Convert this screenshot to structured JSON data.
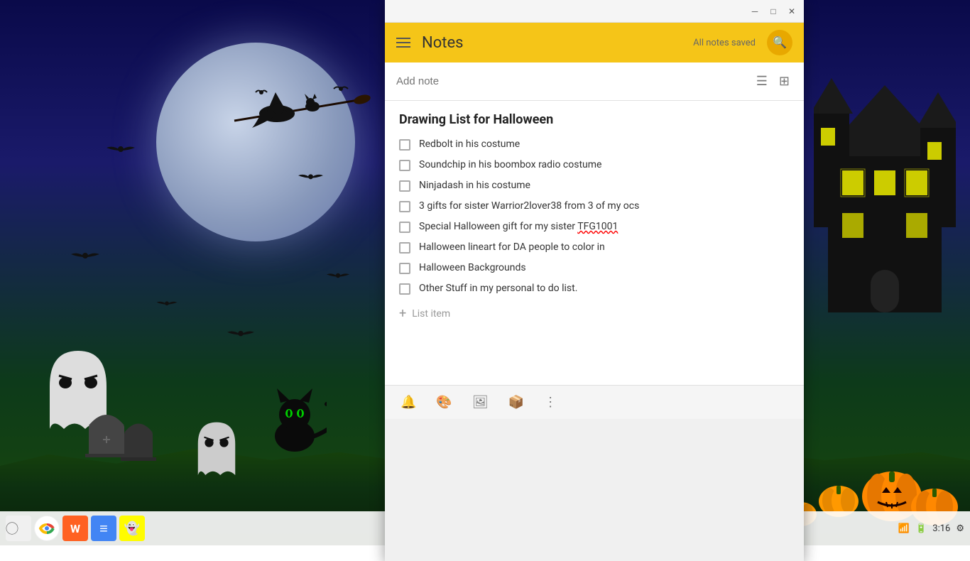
{
  "desktop": {
    "background_description": "Halloween night scene with moon, witch, haunted house, ghosts, bats, pumpkins"
  },
  "window": {
    "title": "Notes",
    "minimize_label": "minimize",
    "maximize_label": "maximize",
    "close_label": "close"
  },
  "notes_header": {
    "title": "Notes",
    "status": "All notes saved",
    "search_label": "search"
  },
  "add_note": {
    "placeholder": "Add note"
  },
  "note": {
    "title": "Drawing List for Halloween",
    "items": [
      {
        "id": 1,
        "text": "Redbolt in his costume",
        "checked": false
      },
      {
        "id": 2,
        "text": "Soundchip in his boombox radio costume",
        "checked": false
      },
      {
        "id": 3,
        "text": "Ninjadash in his costume",
        "checked": false
      },
      {
        "id": 4,
        "text": "3 gifts for sister Warrior2lover38 from 3 of my ocs",
        "checked": false
      },
      {
        "id": 5,
        "text": "Special Halloween gift for my sister TFG1001",
        "checked": false,
        "has_link": true,
        "link_text": "TFG1001"
      },
      {
        "id": 6,
        "text": "Halloween lineart for DA people to color in",
        "checked": false
      },
      {
        "id": 7,
        "text": "Halloween Backgrounds",
        "checked": false
      },
      {
        "id": 8,
        "text": "Other Stuff in my personal to do list.",
        "checked": false
      }
    ],
    "add_item_placeholder": "List item"
  },
  "toolbar": {
    "bell_icon": "🔔",
    "palette_icon": "🎨",
    "image_icon": "🖼",
    "archive_icon": "📦",
    "more_icon": "⋮"
  },
  "taskbar": {
    "time": "3:16",
    "apps": [
      {
        "name": "grid-menu",
        "icon": "⊞",
        "color": "#555"
      },
      {
        "name": "chrome",
        "icon": "●",
        "color": "#4285f4"
      },
      {
        "name": "app2",
        "icon": "M",
        "color": "#0f9d58"
      },
      {
        "name": "docs",
        "icon": "≡",
        "color": "#4285f4"
      },
      {
        "name": "snapchat",
        "icon": "👻",
        "color": "#fffc00"
      }
    ]
  }
}
